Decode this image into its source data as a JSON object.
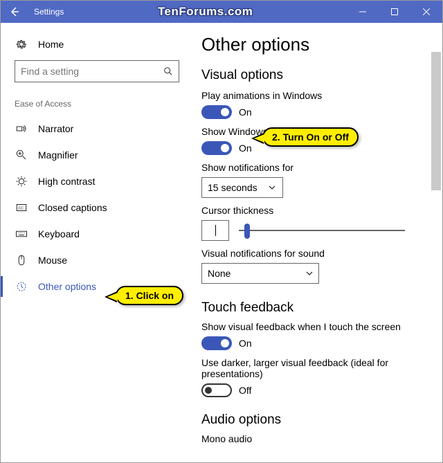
{
  "titlebar": {
    "title": "Settings",
    "watermark": "TenForums.com"
  },
  "sidebar": {
    "home": "Home",
    "search_placeholder": "Find a setting",
    "section": "Ease of Access",
    "items": [
      {
        "label": "Narrator"
      },
      {
        "label": "Magnifier"
      },
      {
        "label": "High contrast"
      },
      {
        "label": "Closed captions"
      },
      {
        "label": "Keyboard"
      },
      {
        "label": "Mouse"
      },
      {
        "label": "Other options"
      }
    ]
  },
  "main": {
    "title": "Other options",
    "visual_heading": "Visual options",
    "anim_label": "Play animations in Windows",
    "anim_state": "On",
    "bg_label": "Show Windows background",
    "bg_state": "On",
    "notif_label": "Show notifications for",
    "notif_value": "15 seconds",
    "cursor_label": "Cursor thickness",
    "visnotif_label": "Visual notifications for sound",
    "visnotif_value": "None",
    "touch_heading": "Touch feedback",
    "touch_label": "Show visual feedback when I touch the screen",
    "touch_state": "On",
    "darker_label": "Use darker, larger visual feedback (ideal for presentations)",
    "darker_state": "Off",
    "audio_heading": "Audio options",
    "mono_label": "Mono audio"
  },
  "callouts": {
    "c1": "1. Click on",
    "c2": "2. Turn On or Off"
  }
}
